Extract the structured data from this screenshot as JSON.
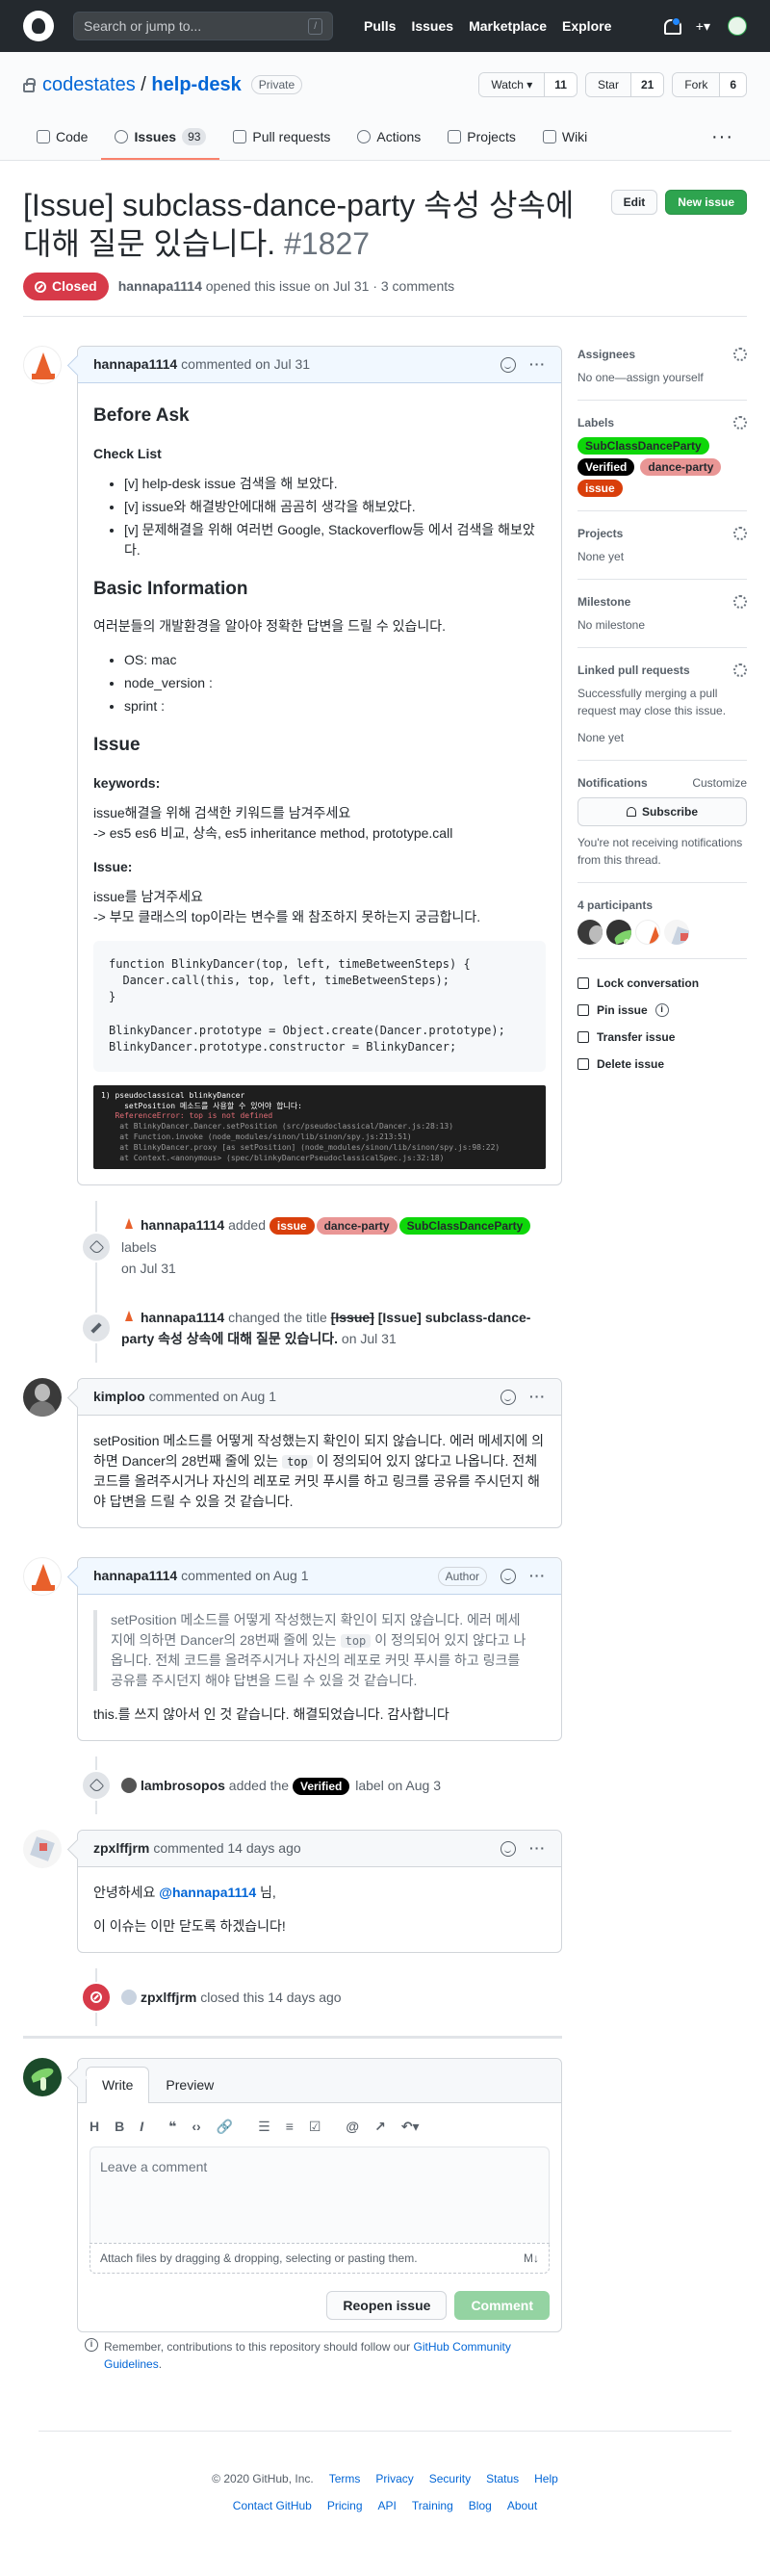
{
  "topnav": {
    "search_placeholder": "Search or jump to...",
    "slash": "/",
    "items": [
      "Pulls",
      "Issues",
      "Marketplace",
      "Explore"
    ],
    "plus": "+▾"
  },
  "repo": {
    "owner": "codestates",
    "sep": "/",
    "name": "help-desk",
    "visibility": "Private",
    "watch": "Watch ▾",
    "watch_count": "11",
    "star": "Star",
    "star_count": "21",
    "fork": "Fork",
    "fork_count": "6"
  },
  "tabs": [
    {
      "label": "Code"
    },
    {
      "label": "Issues",
      "count": "93"
    },
    {
      "label": "Pull requests"
    },
    {
      "label": "Actions"
    },
    {
      "label": "Projects"
    },
    {
      "label": "Wiki"
    }
  ],
  "more": "···",
  "issue": {
    "title": "[Issue] subclass-dance-party 속성 상속에 대해 질문 있습니다.",
    "number": "#1827",
    "edit": "Edit",
    "new_issue": "New issue",
    "state": "Closed",
    "author": "hannapa1114",
    "opened": "opened this issue on Jul 31 · 3 comments"
  },
  "c1": {
    "author": "hannapa1114",
    "when": "commented on Jul 31",
    "h_before": "Before Ask",
    "h_check": "Check List",
    "checks": [
      "[v] help-desk issue 검색을 해 보았다.",
      "[v] issue와 해결방안에대해 곰곰히 생각을 해보았다.",
      "[v] 문제해결을 위해 여러번 Google, Stackoverflow등 에서 검색을 해보았다."
    ],
    "h_basic": "Basic Information",
    "basic_p": "여러분들의 개발환경을 알아야 정확한 답변을 드릴 수 있습니다.",
    "env": [
      "OS: mac",
      "node_version :",
      "sprint :"
    ],
    "h_issue": "Issue",
    "h_keywords": "keywords:",
    "kw1": "issue해결을 위해 검색한 키워드를 남겨주세요",
    "kw2": "-> es5 es6 비교, 상속, es5 inheritance method, prototype.call",
    "h_issue2": "Issue:",
    "is1": "issue를 남겨주세요",
    "is2": "-> 부모 클래스의 top이라는 변수를 왜 참조하지 못하는지 궁금합니다.",
    "code": "function BlinkyDancer(top, left, timeBetweenSteps) {\n  Dancer.call(this, top, left, timeBetweenSteps);\n}\n\nBlinkyDancer.prototype = Object.create(Dancer.prototype);\nBlinkyDancer.prototype.constructor = BlinkyDancer;",
    "term1": "1) pseudoclassical blinkyDancer",
    "term2": "     setPosition 메소드를 사용할 수 있어야 합니다:",
    "term3": "   ReferenceError: top is not defined",
    "term4": "    at BlinkyDancer.Dancer.setPosition (src/pseudoclassical/Dancer.js:28:13)\n    at Function.invoke (node_modules/sinon/lib/sinon/spy.js:213:51)\n    at BlinkyDancer.proxy [as setPosition] (node_modules/sinon/lib/sinon/spy.js:98:22)\n    at Context.<anonymous> (spec/blinkyDancerPseudoclassicalSpec.js:32:18)"
  },
  "ev1": {
    "actor": "hannapa1114",
    "pre": "added",
    "post": "labels",
    "when": "on Jul 31"
  },
  "ev2": {
    "actor": "hannapa1114",
    "pre": "changed the title",
    "old": "[Issue]",
    "new": "[Issue] subclass-dance-party 속성 상속에 대해 질문 있습니다.",
    "when": "on Jul 31"
  },
  "c2": {
    "author": "kimploo",
    "when": "commented on Aug 1",
    "body1": "setPosition 메소드를 어떻게 작성했는지 확인이 되지 않습니다. 에러 메세지에 의하면 Dancer의 28번째 줄에 있는",
    "code": "top",
    "body2": "이 정의되어 있지 않다고 나옵니다. 전체 코드를 올려주시거나 자신의 레포로 커밋 푸시를 하고 링크를 공유를 주시던지 해야 답변을 드릴 수 있을 것 같습니다."
  },
  "c3": {
    "author": "hannapa1114",
    "when": "commented on Aug 1",
    "badge": "Author",
    "q1": "setPosition 메소드를 어떻게 작성했는지 확인이 되지 않습니다. 에러 메세지에 의하면 Dancer의 28번째 줄에 있는",
    "qcode": "top",
    "q2": "이 정의되어 있지 않다고 나옵니다. 전체 코드를 올려주시거나 자신의 레포로 커밋 푸시를 하고 링크를 공유를 주시던지 해야 답변을 드릴 수 있을 것 같습니다.",
    "body": "this.를 쓰지 않아서 인 것 같습니다. 해결되었습니다. 감사합니다"
  },
  "ev3": {
    "actor": "lambrosopos",
    "pre": "added the",
    "post": "label",
    "when": "on Aug 3"
  },
  "c4": {
    "author": "zpxlffjrm",
    "when": "commented 14 days ago",
    "greet1": "안녕하세요",
    "mention": "@hannapa1114",
    "greet2": "님,",
    "body": "이 이슈는 이만 닫도록 하겠습니다!"
  },
  "ev4": {
    "actor": "zpxlffjrm",
    "action": "closed this",
    "when": "14 days ago"
  },
  "labels": {
    "issue": "issue",
    "dance": "dance-party",
    "sub": "SubClassDanceParty",
    "verified": "Verified"
  },
  "editor": {
    "write": "Write",
    "preview": "Preview",
    "tools": [
      "H",
      "B",
      "I",
      "❝",
      "‹›",
      "🔗",
      "☰",
      "≡",
      "☑",
      "@",
      "↗",
      "↶▾"
    ],
    "placeholder": "Leave a comment",
    "attach": "Attach files by dragging & dropping, selecting or pasting them.",
    "md": "M↓",
    "reopen": "Reopen issue",
    "comment": "Comment"
  },
  "remember": {
    "text": "Remember, contributions to this repository should follow our",
    "link": "GitHub Community Guidelines",
    "end": "."
  },
  "sidebar": {
    "assignees": "Assignees",
    "assignees_val": "No one—assign yourself",
    "labels": "Labels",
    "projects": "Projects",
    "projects_val": "None yet",
    "milestone": "Milestone",
    "milestone_val": "No milestone",
    "linked": "Linked pull requests",
    "linked_val": "Successfully merging a pull request may close this issue.",
    "linked_val2": "None yet",
    "notifications": "Notifications",
    "customize": "Customize",
    "subscribe": "Subscribe",
    "notif_text": "You're not receiving notifications from this thread.",
    "participants": "4 participants",
    "lock": "Lock conversation",
    "pin": "Pin issue",
    "transfer": "Transfer issue",
    "delete": "Delete issue"
  },
  "footer": {
    "copy": "© 2020 GitHub, Inc.",
    "row1": [
      "Terms",
      "Privacy",
      "Security",
      "Status",
      "Help"
    ],
    "row2": [
      "Contact GitHub",
      "Pricing",
      "API",
      "Training",
      "Blog",
      "About"
    ]
  }
}
